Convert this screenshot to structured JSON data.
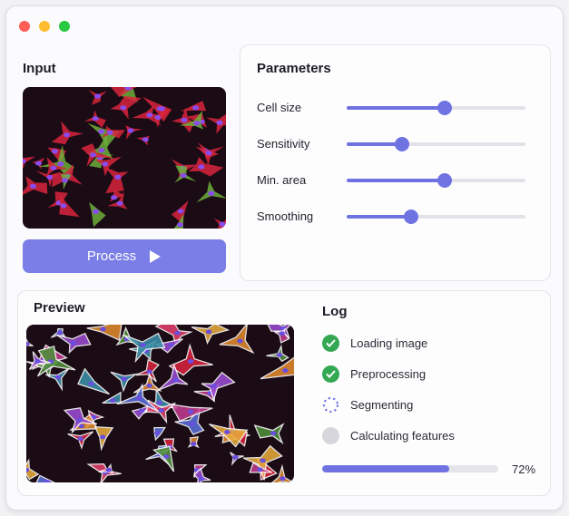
{
  "window": {
    "lights": [
      {
        "name": "close",
        "color": "#ff5f57"
      },
      {
        "name": "minimize",
        "color": "#febc2e"
      },
      {
        "name": "zoom",
        "color": "#28c840"
      }
    ]
  },
  "input": {
    "title": "Input",
    "image_icon": "fluorescent-cells-image",
    "process_label": "Process",
    "process_icon": "play-icon"
  },
  "parameters": {
    "title": "Parameters",
    "items": [
      {
        "label": "Cell size",
        "level": 0.55
      },
      {
        "label": "Sensitivity",
        "level": 0.31
      },
      {
        "label": "Min. area",
        "level": 0.55
      },
      {
        "label": "Smoothing",
        "level": 0.36
      }
    ]
  },
  "preview": {
    "title": "Preview",
    "image_icon": "segmented-cells-image"
  },
  "log": {
    "title": "Log",
    "steps": [
      {
        "label": "Loading image",
        "status": "done"
      },
      {
        "label": "Preprocessing",
        "status": "done"
      },
      {
        "label": "Segmenting",
        "status": "running"
      },
      {
        "label": "Calculating features",
        "status": "pending"
      }
    ],
    "progress": 0.72,
    "progress_label": "72%"
  },
  "colors": {
    "accent": "#6f73e2",
    "button": "#7a7ee6",
    "done": "#34a853",
    "pending": "#d6d6dc"
  }
}
